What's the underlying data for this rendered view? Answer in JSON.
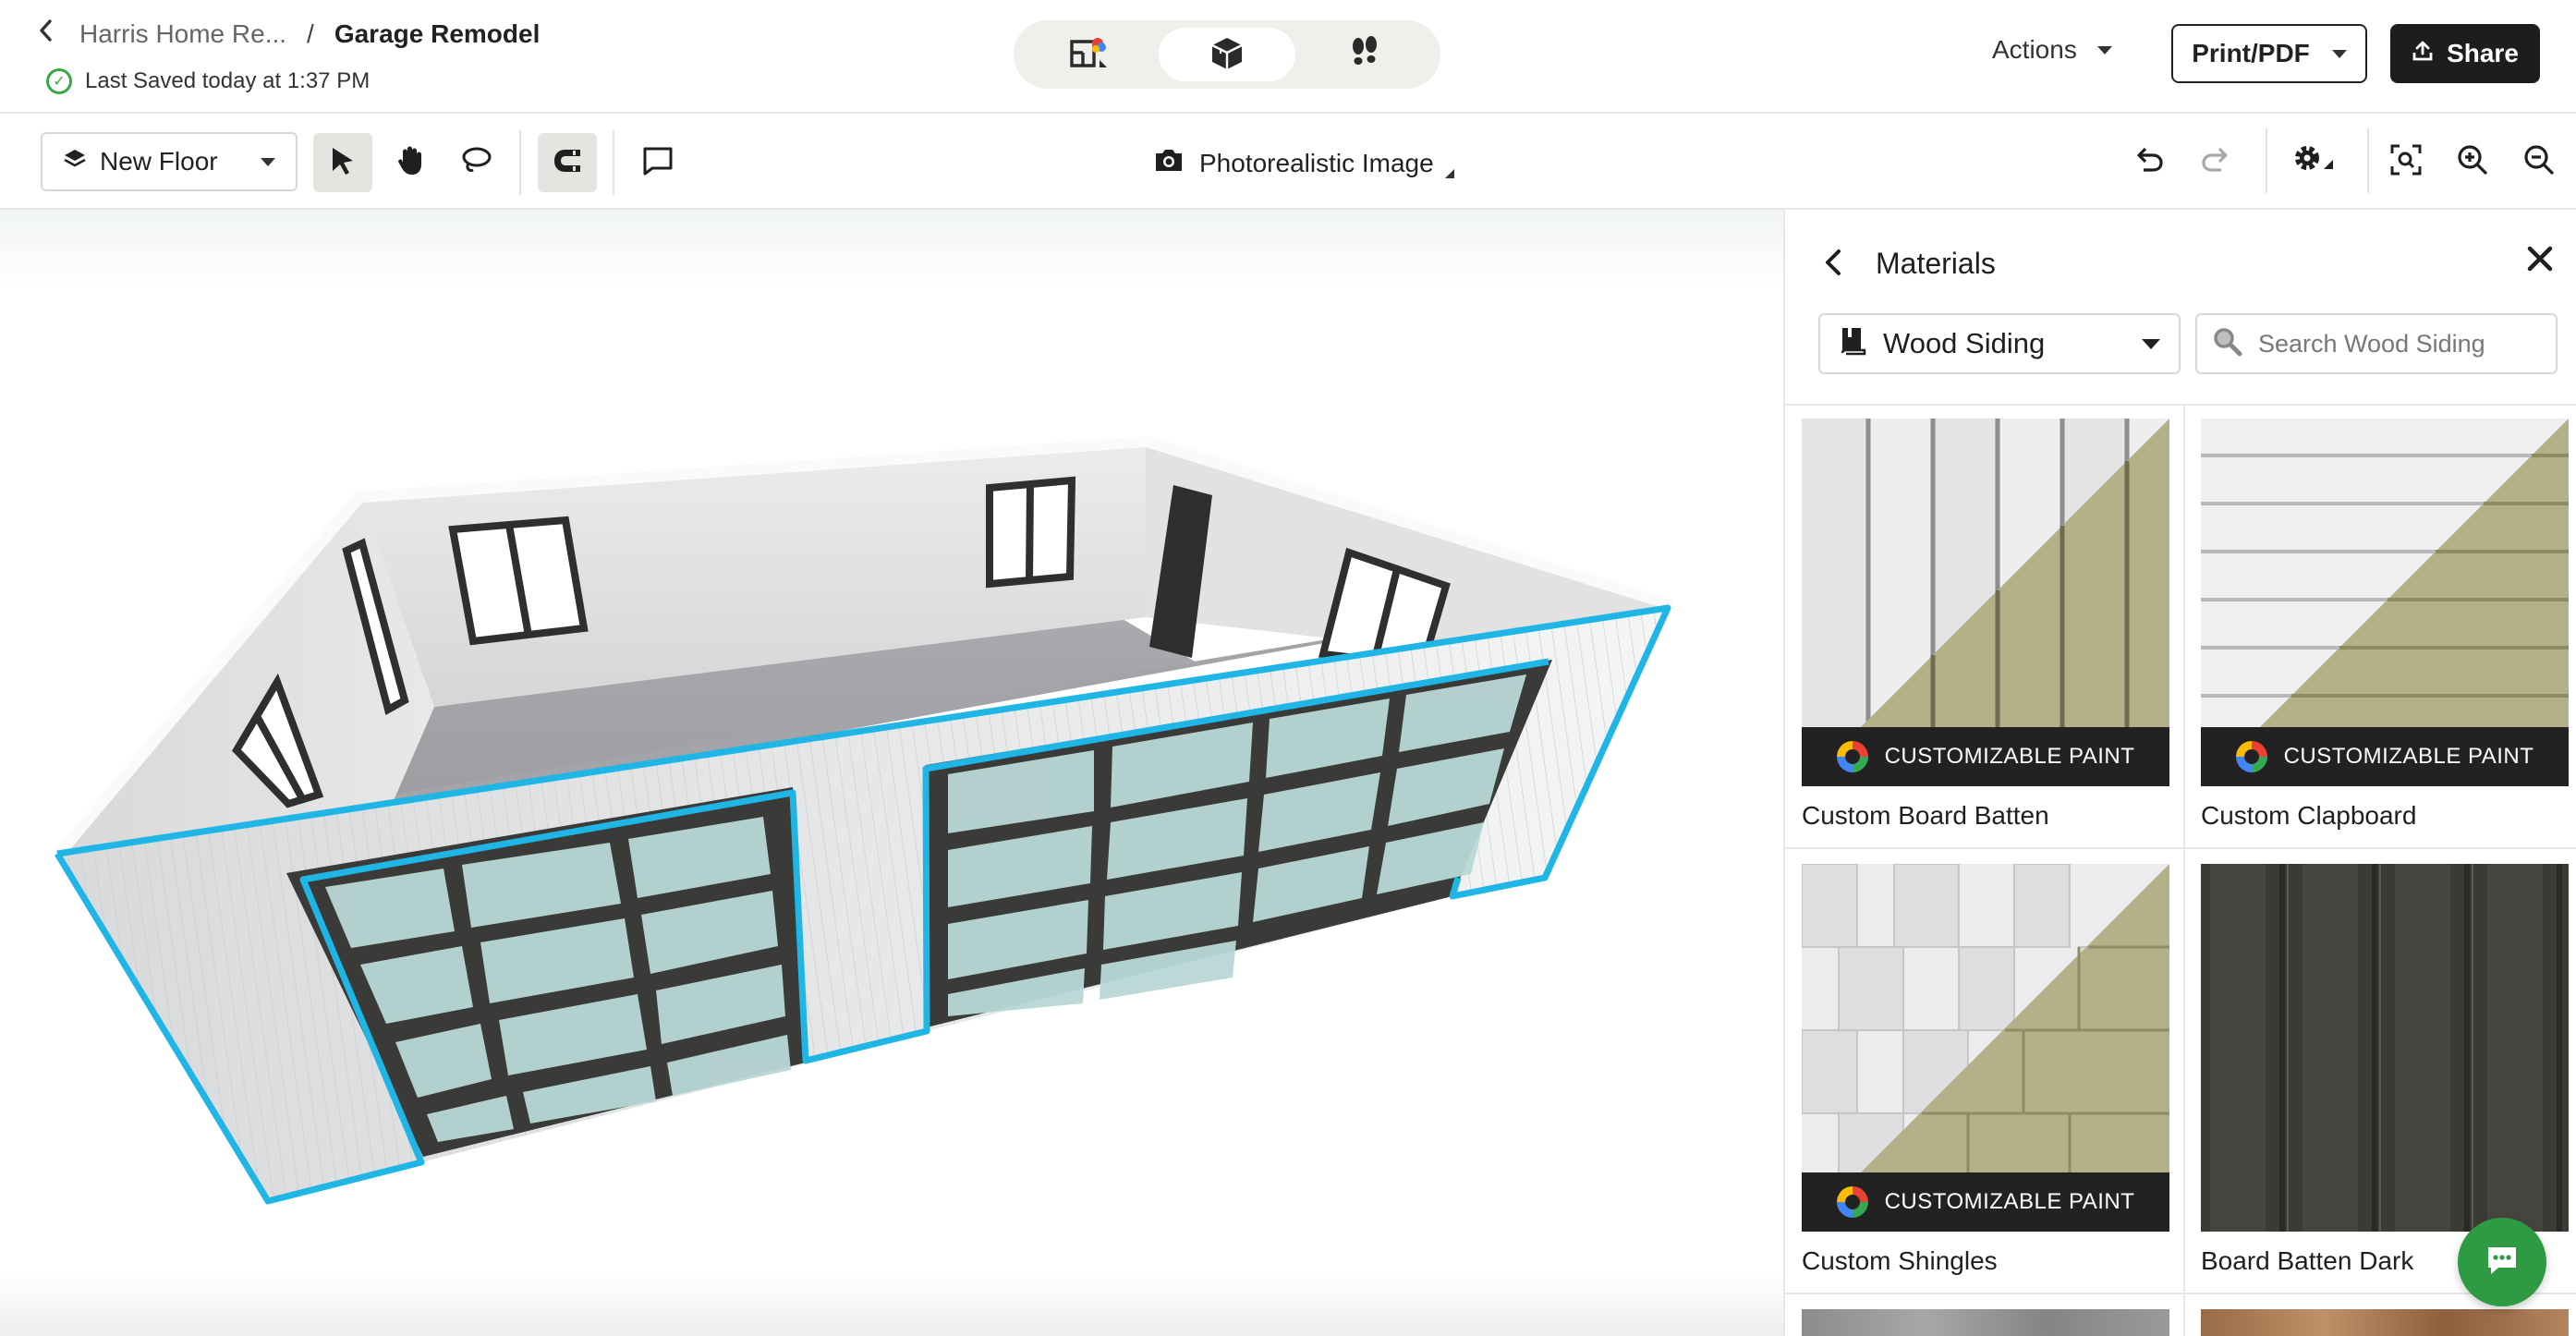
{
  "header": {
    "breadcrumb_parent": "Harris Home Re...",
    "breadcrumb_separator": "/",
    "project_title": "Garage Remodel",
    "saved_status": "Last Saved today at 1:37 PM",
    "view_modes": [
      {
        "name": "2d-floorplan",
        "icon": "floorplan-icon",
        "active": false
      },
      {
        "name": "3d-view",
        "icon": "cube-icon",
        "active": true
      },
      {
        "name": "walkthrough",
        "icon": "footsteps-icon",
        "active": false
      }
    ],
    "actions_label": "Actions",
    "print_label": "Print/PDF",
    "share_label": "Share"
  },
  "toolbar": {
    "floor_label": "New Floor",
    "photo_label": "Photorealistic Image",
    "tools": [
      "select-arrow-icon",
      "pan-hand-icon",
      "lasso-icon",
      "magnet-icon",
      "comment-icon"
    ],
    "right_tools": [
      "undo-icon",
      "redo-icon",
      "settings-gear-icon",
      "zoom-fit-icon",
      "zoom-in-icon",
      "zoom-out-icon"
    ]
  },
  "panel": {
    "title": "Materials",
    "category": "Wood Siding",
    "search_placeholder": "Search Wood Siding",
    "badge_text": "CUSTOMIZABLE PAINT",
    "items": [
      {
        "name": "Custom Board Batten",
        "customizable": true
      },
      {
        "name": "Custom Clapboard",
        "customizable": true
      },
      {
        "name": "Custom Shingles",
        "customizable": true
      },
      {
        "name": "Board Batten Dark",
        "customizable": false
      }
    ]
  },
  "colors": {
    "accent_selection": "#1fb6e6",
    "paint_swatch": "#b4b088",
    "share_bg": "#1d1d1d",
    "chat_bg": "#2e9b42",
    "saved_ok": "#39a845"
  }
}
